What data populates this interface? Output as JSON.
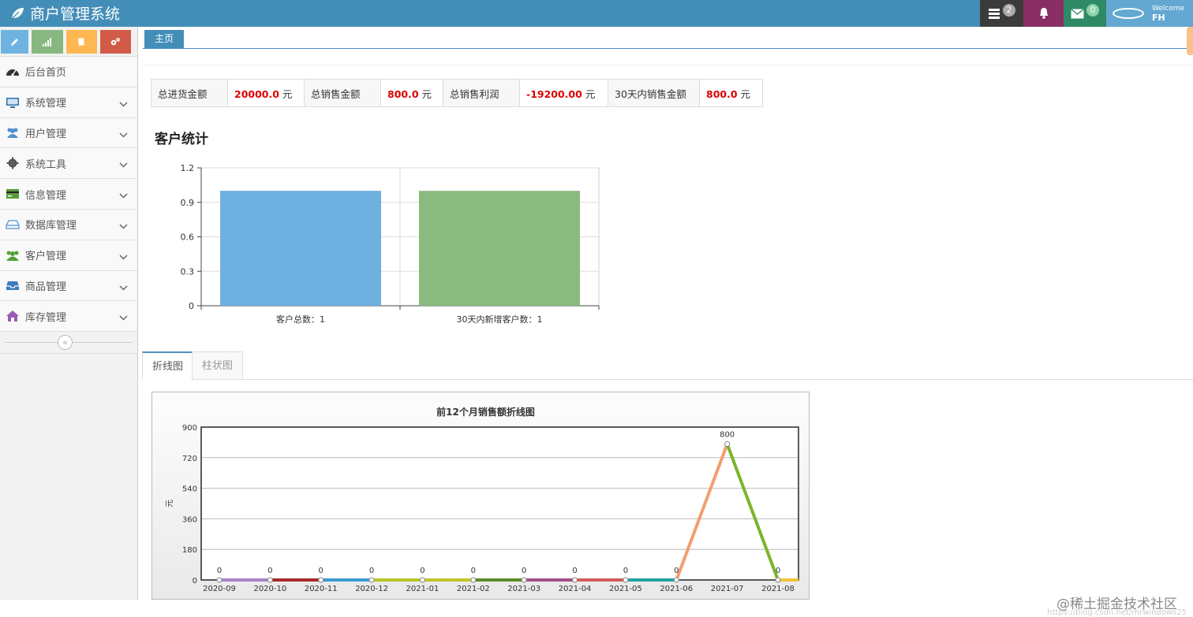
{
  "app": {
    "title": "商户管理系统"
  },
  "navbar": {
    "tasks_count": "2",
    "mail_count": "0",
    "welcome": "Welcome",
    "user": "FH"
  },
  "sidebar": {
    "items": [
      {
        "label": "后台首页",
        "icon": "dashboard-icon",
        "color": "#333333"
      },
      {
        "label": "系统管理",
        "icon": "desktop-icon",
        "color": "#2e6fa8"
      },
      {
        "label": "用户管理",
        "icon": "users-icon",
        "color": "#4d8fce"
      },
      {
        "label": "系统工具",
        "icon": "cog-icon",
        "color": "#555555"
      },
      {
        "label": "信息管理",
        "icon": "credit-card-icon",
        "color": "#5a9a3a"
      },
      {
        "label": "数据库管理",
        "icon": "hdd-icon",
        "color": "#6fa3d6"
      },
      {
        "label": "客户管理",
        "icon": "group-icon",
        "color": "#55a039"
      },
      {
        "label": "商品管理",
        "icon": "inbox-icon",
        "color": "#3b7bbf"
      },
      {
        "label": "库存管理",
        "icon": "home-icon",
        "color": "#9b59b6"
      }
    ]
  },
  "tabs": {
    "home": "主页"
  },
  "stats": {
    "purchase_label": "总进货金额",
    "purchase_value": "20000.0",
    "purchase_unit": "元",
    "sales_label": "总销售金额",
    "sales_value": "800.0",
    "sales_unit": "元",
    "profit_label": "总销售利润",
    "profit_value": "-19200.00",
    "profit_unit": "元",
    "recent_label": "30天内销售金额",
    "recent_value": "800.0",
    "recent_unit": "元"
  },
  "customer_section": {
    "title": "客户统计"
  },
  "chart_tabs": {
    "line": "折线图",
    "bar": "柱状图"
  },
  "watermark": {
    "text": "@稀土掘金技术社区",
    "small": "https://blog.csdn.net/mrwindows25"
  },
  "chart_data": [
    {
      "type": "bar",
      "categories": [
        "客户总数：1",
        "30天内新增客户数：1"
      ],
      "values": [
        1,
        1
      ],
      "colors": [
        "#6eb0e0",
        "#8aba7f"
      ],
      "ylim": [
        0,
        1.2
      ],
      "yticks": [
        "0",
        "0.3",
        "0.6",
        "0.9",
        "1.2"
      ],
      "grid": true
    },
    {
      "type": "line",
      "title": "前12个月销售额折线图",
      "ylabel": "元",
      "categories": [
        "2020-09",
        "2020-10",
        "2020-11",
        "2020-12",
        "2021-01",
        "2021-02",
        "2021-03",
        "2021-04",
        "2021-05",
        "2021-06",
        "2021-07",
        "2021-08"
      ],
      "values": [
        0,
        0,
        0,
        0,
        0,
        0,
        0,
        0,
        0,
        0,
        800,
        0
      ],
      "segment_colors": [
        "#a983c7",
        "#a52a2a",
        "#3b9bcf",
        "#b8c42b",
        "#c2c42b",
        "#5b8c2a",
        "#a1508a",
        "#d45a5a",
        "#22a3a3",
        "#f0a070",
        "#7bb52b",
        "#f2c23c"
      ],
      "ylim": [
        0,
        900
      ],
      "yticks": [
        "0",
        "180",
        "360",
        "540",
        "720",
        "900"
      ],
      "grid": true
    }
  ]
}
